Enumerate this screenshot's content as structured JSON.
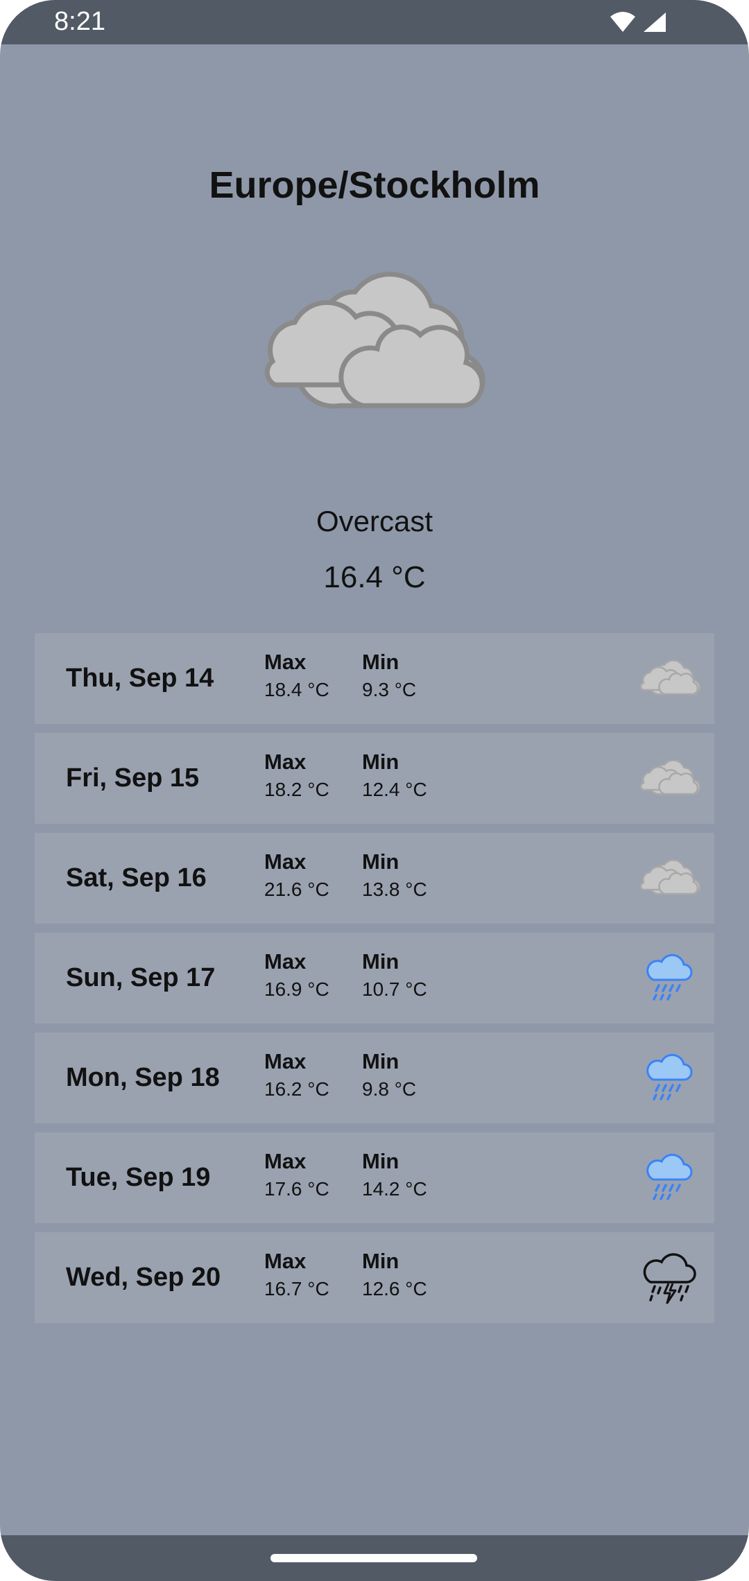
{
  "status_bar": {
    "time": "8:21"
  },
  "location": "Europe/Stockholm",
  "current": {
    "icon": "overcast-cloud-icon",
    "condition": "Overcast",
    "temperature": "16.4 °C"
  },
  "labels": {
    "max": "Max",
    "min": "Min"
  },
  "forecast": [
    {
      "day": "Thu, Sep 14",
      "max": "18.4 °C",
      "min": "9.3 °C",
      "icon": "overcast-cloud-icon"
    },
    {
      "day": "Fri, Sep 15",
      "max": "18.2 °C",
      "min": "12.4 °C",
      "icon": "overcast-cloud-icon"
    },
    {
      "day": "Sat, Sep 16",
      "max": "21.6 °C",
      "min": "13.8 °C",
      "icon": "overcast-cloud-icon"
    },
    {
      "day": "Sun, Sep 17",
      "max": "16.9 °C",
      "min": "10.7 °C",
      "icon": "rain-cloud-icon"
    },
    {
      "day": "Mon, Sep 18",
      "max": "16.2 °C",
      "min": "9.8 °C",
      "icon": "rain-cloud-icon"
    },
    {
      "day": "Tue, Sep 19",
      "max": "17.6 °C",
      "min": "14.2 °C",
      "icon": "rain-cloud-icon"
    },
    {
      "day": "Wed, Sep 20",
      "max": "16.7 °C",
      "min": "12.6 °C",
      "icon": "thunderstorm-cloud-icon"
    }
  ],
  "colors": {
    "background": "#8e98a8",
    "row_background": "#9aa2b0",
    "system_bars": "#525a65",
    "rain_icon": "#3b82f6"
  }
}
